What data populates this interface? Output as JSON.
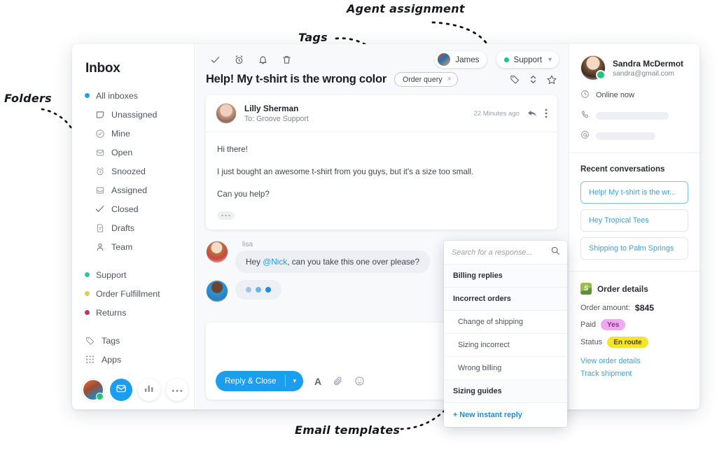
{
  "annotations": [
    {
      "id": "folders",
      "text": "Folders"
    },
    {
      "id": "tags",
      "text": "Tags"
    },
    {
      "id": "agent_assignment",
      "text": "Agent assignment"
    },
    {
      "id": "email_templates",
      "text": "Email templates"
    }
  ],
  "sidebar": {
    "title": "Inbox",
    "items": [
      {
        "label": "All inboxes",
        "icon": "dot-icon",
        "kind": "dot",
        "color": "#19a3ef",
        "indent": false
      },
      {
        "label": "Unassigned",
        "icon": "inbox-tray-icon",
        "kind": "icon",
        "indent": true
      },
      {
        "label": "Mine",
        "icon": "check-circle-icon",
        "kind": "icon",
        "indent": true
      },
      {
        "label": "Open",
        "icon": "envelope-open-icon",
        "kind": "icon",
        "indent": true
      },
      {
        "label": "Snoozed",
        "icon": "alarm-clock-icon",
        "kind": "icon",
        "indent": true
      },
      {
        "label": "Assigned",
        "icon": "tray-icon",
        "kind": "icon",
        "indent": true
      },
      {
        "label": "Closed",
        "icon": "check-icon",
        "kind": "icon",
        "indent": true
      },
      {
        "label": "Drafts",
        "icon": "draft-file-icon",
        "kind": "icon",
        "indent": true
      },
      {
        "label": "Team",
        "icon": "person-icon",
        "kind": "icon",
        "indent": true
      }
    ],
    "channels": [
      {
        "label": "Support",
        "color": "#2ac6a4"
      },
      {
        "label": "Order Fulfillment",
        "color": "#ecc94b"
      },
      {
        "label": "Returns",
        "color": "#c0356f"
      }
    ],
    "utilities": [
      {
        "label": "Tags",
        "icon": "tag-icon"
      },
      {
        "label": "Apps",
        "icon": "grid-dots-icon"
      }
    ],
    "footer": [
      {
        "name": "user-avatar",
        "icon": "avatar-icon"
      },
      {
        "name": "inbox-button",
        "icon": "envelope-icon"
      },
      {
        "name": "reports-button",
        "icon": "bar-chart-icon"
      },
      {
        "name": "more-button",
        "icon": "ellipsis-icon"
      }
    ]
  },
  "conversation": {
    "toolbar_icons": [
      {
        "name": "mark-done-icon",
        "icon": "check-icon"
      },
      {
        "name": "snooze-icon",
        "icon": "alarm-clock-icon"
      },
      {
        "name": "notify-icon",
        "icon": "bell-icon"
      },
      {
        "name": "delete-icon",
        "icon": "trash-icon"
      }
    ],
    "assignee": {
      "label": "James"
    },
    "status": {
      "label": "Support",
      "color": "#1fc08a"
    },
    "subject": "Help! My t-shirt is the wrong color",
    "tag": {
      "label": "Order query",
      "close": "×"
    },
    "subject_actions": [
      {
        "name": "add-tag-icon",
        "icon": "tag-icon"
      },
      {
        "name": "reorder-icon",
        "icon": "updown-icon"
      },
      {
        "name": "star-icon",
        "icon": "star-icon"
      }
    ],
    "message": {
      "author": "Lilly Sherman",
      "to": "To: Groove Support",
      "time": "22 Minutes ago",
      "actions": [
        {
          "name": "reply-icon",
          "icon": "reply-arrow-icon"
        },
        {
          "name": "message-more-icon",
          "icon": "vertical-ellipsis-icon"
        }
      ],
      "paragraphs": [
        "Hi there!",
        "I just bought an awesome t-shirt from you guys, but it's a size too small.",
        "Can you help?"
      ]
    },
    "note": {
      "author": "lisa",
      "text_before": "Hey ",
      "mention": "@Nick",
      "text_after": ", can you take this one over please?"
    },
    "composer": {
      "send_label": "Reply & Close",
      "dropdown_caret": "▾",
      "tools": [
        {
          "name": "format-text-icon",
          "glyph": "A"
        },
        {
          "name": "attachment-icon",
          "glyph": "paperclip"
        },
        {
          "name": "emoji-icon",
          "glyph": "smiley"
        }
      ]
    }
  },
  "instant_reply": {
    "search_placeholder": "Search for a response...",
    "search_value": "",
    "groups": [
      {
        "label": "Billing replies",
        "type": "group"
      },
      {
        "label": "Incorrect orders",
        "type": "group"
      },
      {
        "label": "Change of shipping",
        "type": "item"
      },
      {
        "label": "Sizing incorrect",
        "type": "item"
      },
      {
        "label": "Wrong billing",
        "type": "item"
      },
      {
        "label": "Sizing guides",
        "type": "group"
      }
    ],
    "new_reply_label": "+ New instant reply"
  },
  "right_panel": {
    "contact": {
      "name": "Sandra McDermot",
      "email": "sandra@gmail.com",
      "presence": "Online now",
      "phone_redacted": true,
      "handle_redacted": true
    },
    "recent": {
      "heading": "Recent conversations",
      "items": [
        {
          "label": "Help! My t-shirt is the wr...",
          "active": true
        },
        {
          "label": "Hey Tropical Tees",
          "active": false
        },
        {
          "label": "Shipping to Palm Springs",
          "active": false
        }
      ]
    },
    "order": {
      "heading": "Order details",
      "source_icon": "shopify-icon",
      "amount_label": "Order amount:",
      "amount_value": "$845",
      "paid_label": "Paid",
      "paid_value": "Yes",
      "status_label": "Status",
      "status_value": "En route",
      "links": [
        "View order details",
        "Track shipment"
      ]
    }
  }
}
